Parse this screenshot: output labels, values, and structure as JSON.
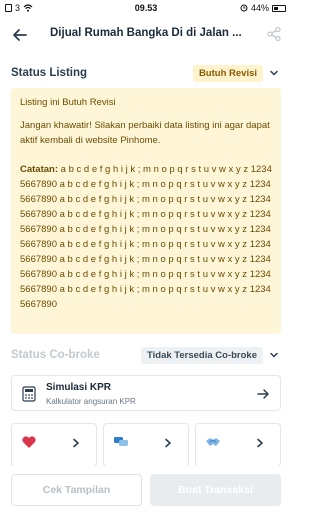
{
  "status_bar": {
    "sim": "3",
    "time": "09.53",
    "battery": "44%",
    "battery_level": 0.44
  },
  "header": {
    "title": "Dijual Rumah Bangka Di di Jalan ..."
  },
  "status_listing": {
    "title": "Status Listing",
    "badge": "Butuh Revisi",
    "notice_title": "Listing ini Butuh Revisi",
    "notice_body": "Jangan khawatir! Silakan perbaiki data listing ini agar dapat aktif kembali di website Pinhome.",
    "note_label": "Catatan:",
    "note_text": " a b c d e f g h i j k ; m n o p q r s t u v w x y z 12345667890 a b c d e f g h i j k ; m n o p q r s t u v w x y z 12345667890 a b c d e f g h i j k ; m n o p q r s t u v w x y z 12345667890 a b c d e f g h i j k ; m n o p q r s t u v w x y z 12345667890 a b c d e f g h i j k ; m n o p q r s t u v w x y z 12345667890 a b c d e f g h i j k ; m n o p q r s t u v w x y z 12345667890 a b c d e f g h i j k ; m n o p q r s t u v w x y z 12345667890 a b c d e f g h i j k ; m n o p q r s t u v w x y z 12345667890 a b c d e f g h i j k ; m n o p q r s t u v w x y z 12345667890"
  },
  "status_cobroke": {
    "title": "Status Co-broke",
    "badge": "Tidak Tersedia Co-broke"
  },
  "kpr": {
    "title": "Simulasi KPR",
    "subtitle": "Kalkulator angsuran KPR"
  },
  "icons": {
    "back": "arrow-left-icon",
    "share": "share-icon",
    "calculator": "calculator-icon",
    "heart": "heart-icon",
    "chat": "chat-icon",
    "handshake": "handshake-icon"
  },
  "colors": {
    "notice_bg": "#fff6d8",
    "notice_text": "#6b4c00",
    "badge_revisi_bg": "#fff3cd",
    "heart": "#d9364b",
    "chat": "#2f80c8"
  },
  "actions": {
    "cek_tampilan": "Cek Tampilan",
    "buat_transaksi": "Buat Transaksi"
  }
}
